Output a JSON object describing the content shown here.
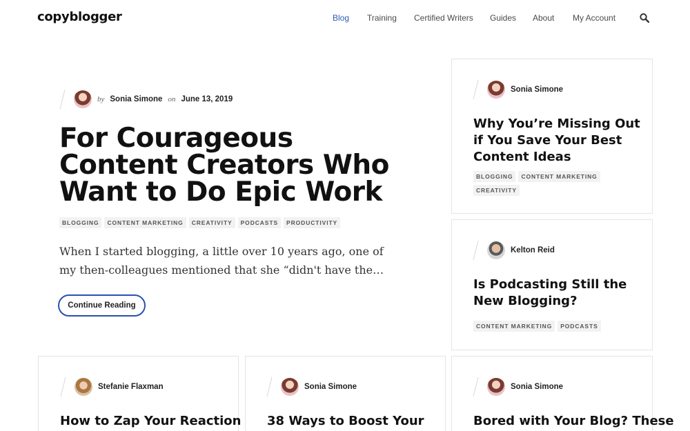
{
  "header": {
    "logo": "copyblogger",
    "nav": [
      "Blog",
      "Training",
      "Certified Writers",
      "Guides",
      "About",
      "My Account"
    ],
    "active_nav": "Blog",
    "search_icon": "search-icon"
  },
  "feature": {
    "by": "by",
    "author": "Sonia Simone",
    "on": "on",
    "date": "June 13, 2019",
    "title": "For Courageous Content Creators Who Want to Do Epic Work",
    "tags": [
      "Blogging",
      "Content Marketing",
      "Creativity",
      "Podcasts",
      "Productivity"
    ],
    "excerpt": "When I started blogging, a little over 10 years ago, one of my then-colleagues mentioned that she “didn't have the…",
    "cta": "Continue Reading"
  },
  "side_posts": [
    {
      "author": "Sonia Simone",
      "title": "Why You’re Missing Out if You Save Your Best Content Ideas",
      "tags": [
        "Blogging",
        "Content Marketing",
        "Creativity"
      ]
    },
    {
      "author": "Kelton Reid",
      "title": "Is Podcasting Still the New Blogging?",
      "tags": [
        "Content Marketing",
        "Podcasts"
      ]
    }
  ],
  "bottom_posts": [
    {
      "author": "Stefanie Flaxman",
      "title": "How to Zap Your Reaction to"
    },
    {
      "author": "Sonia Simone",
      "title": "38 Ways to Boost Your"
    },
    {
      "author": "Sonia Simone",
      "title": "Bored with Your Blog? These"
    }
  ]
}
